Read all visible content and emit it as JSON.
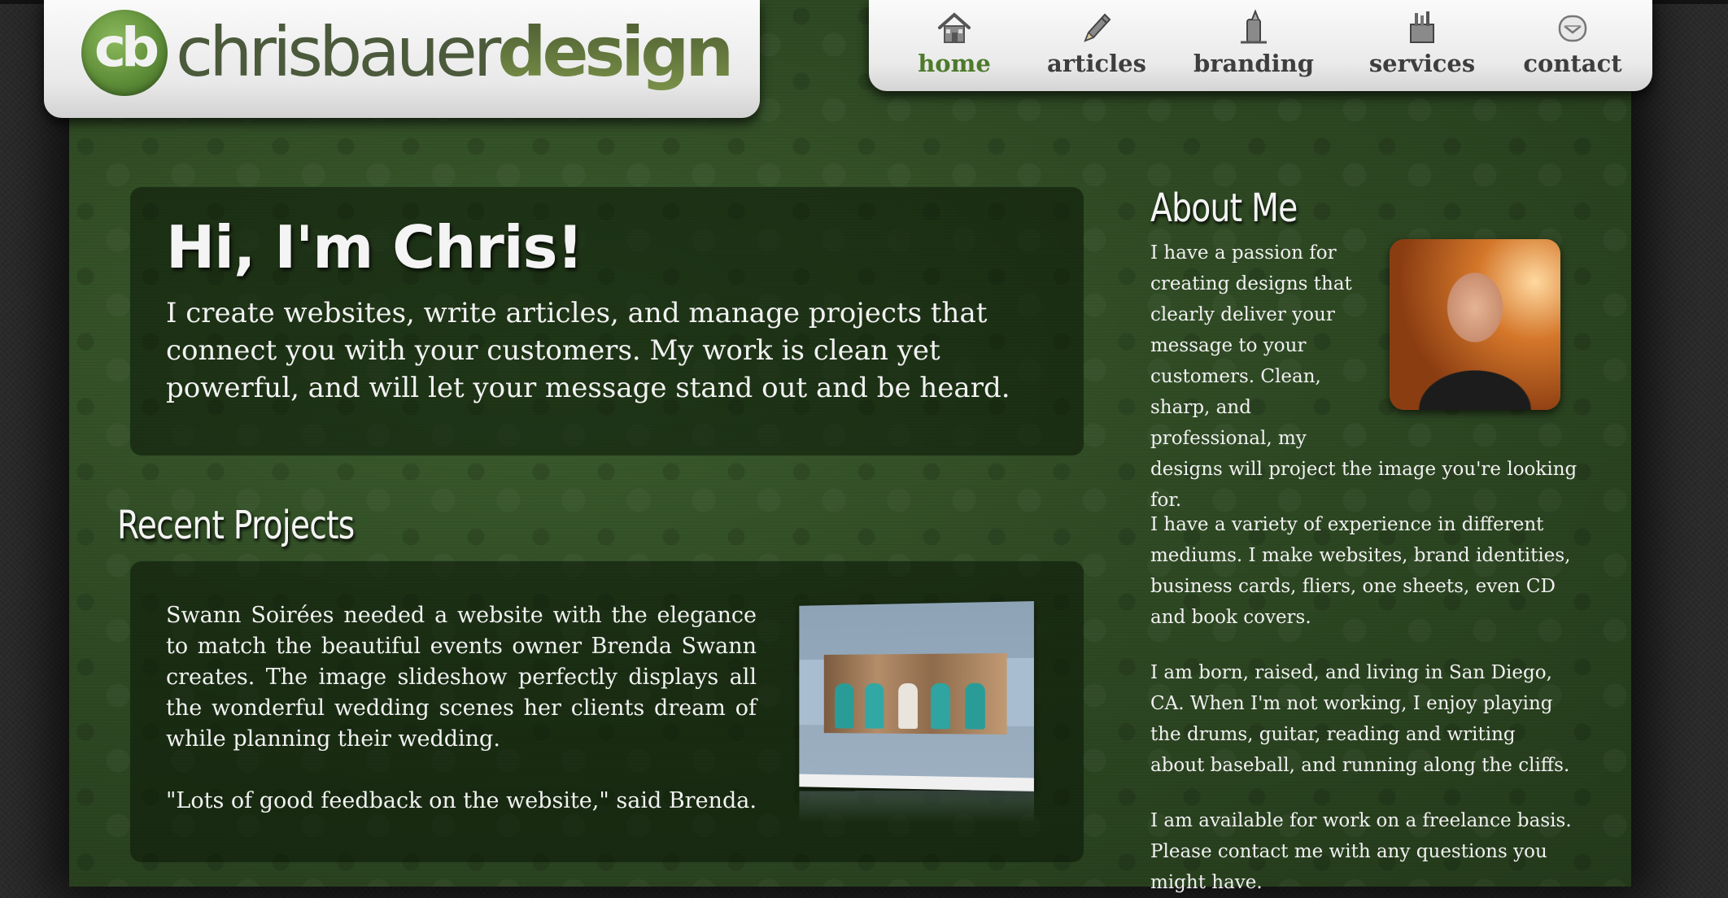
{
  "brand": {
    "logo_mark": "cb",
    "logo_light": "chrisbauer",
    "logo_bold": "design"
  },
  "nav": {
    "items": [
      {
        "label": "home",
        "icon": "home-icon",
        "active": true
      },
      {
        "label": "articles",
        "icon": "pencil-icon",
        "active": false
      },
      {
        "label": "branding",
        "icon": "branding-icon",
        "active": false
      },
      {
        "label": "services",
        "icon": "toolbox-icon",
        "active": false
      },
      {
        "label": "contact",
        "icon": "envelope-icon",
        "active": false
      }
    ]
  },
  "hero": {
    "title": "Hi, I'm Chris!",
    "text": "I create websites, write articles, and manage projects that connect you with your customers. My work is clean yet powerful, and will let your message stand out and be heard."
  },
  "recent": {
    "title": "Recent Projects",
    "project_text": "Swann Soirées needed a website with the elegance to match the beautiful events owner Brenda Swann creates. The image slideshow perfectly displays all the wonderful wedding scenes her clients dream of while planning their wedding.",
    "quote": "\"Lots of good feedback on the website,\" said Brenda."
  },
  "about": {
    "title": "About Me",
    "p1": "I have a passion for creating designs that clearly deliver your message to your customers. Clean, sharp, and professional, my designs will project the image you're looking for.",
    "p2": "I have a variety of experience in different mediums. I make websites, brand identities, business cards, fliers, one sheets, even CD and book covers.",
    "p3": "I am born, raised, and living in San Diego, CA. When I'm not working, I enjoy playing the drums, guitar, reading and writing about baseball, and running along the cliffs.",
    "p4": "I am available for work on a freelance basis. Please contact me with any questions you might have."
  },
  "colors": {
    "accent_green": "#4d7a2b",
    "background": "#2f4a24"
  }
}
